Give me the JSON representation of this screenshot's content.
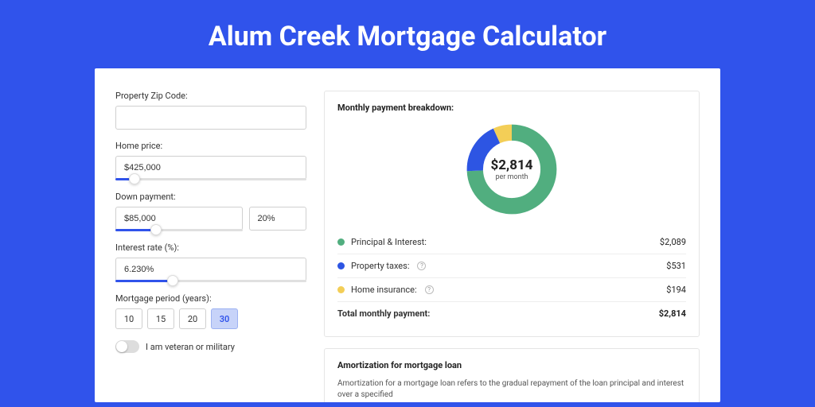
{
  "title": "Alum Creek Mortgage Calculator",
  "form": {
    "zip_label": "Property Zip Code:",
    "zip_value": "",
    "home_price_label": "Home price:",
    "home_price_value": "$425,000",
    "home_price_slider_pct": 10,
    "down_payment_label": "Down payment:",
    "down_payment_value": "$85,000",
    "down_payment_pct_value": "20%",
    "down_payment_slider_pct": 20,
    "interest_label": "Interest rate (%):",
    "interest_value": "6.230%",
    "interest_slider_pct": 30,
    "period_label": "Mortgage period (years):",
    "periods": [
      "10",
      "15",
      "20",
      "30"
    ],
    "period_selected": "30",
    "veteran_label": "I am veteran or military",
    "veteran_on": false
  },
  "breakdown": {
    "heading": "Monthly payment breakdown:",
    "center_amount": "$2,814",
    "center_sub": "per month",
    "items": [
      {
        "label": "Principal & Interest:",
        "value": "$2,089",
        "color": "#51ae7f",
        "info": false
      },
      {
        "label": "Property taxes:",
        "value": "$531",
        "color": "#2d55e3",
        "info": true
      },
      {
        "label": "Home insurance:",
        "value": "$194",
        "color": "#f3ce57",
        "info": true
      }
    ],
    "total_label": "Total monthly payment:",
    "total_value": "$2,814"
  },
  "chart_data": {
    "type": "pie",
    "title": "Monthly payment breakdown",
    "series": [
      {
        "name": "Principal & Interest",
        "value": 2089,
        "color": "#51ae7f"
      },
      {
        "name": "Property taxes",
        "value": 531,
        "color": "#2d55e3"
      },
      {
        "name": "Home insurance",
        "value": 194,
        "color": "#f3ce57"
      }
    ],
    "total": 2814,
    "center_label": "$2,814 per month"
  },
  "amortization": {
    "heading": "Amortization for mortgage loan",
    "text": "Amortization for a mortgage loan refers to the gradual repayment of the loan principal and interest over a specified"
  }
}
